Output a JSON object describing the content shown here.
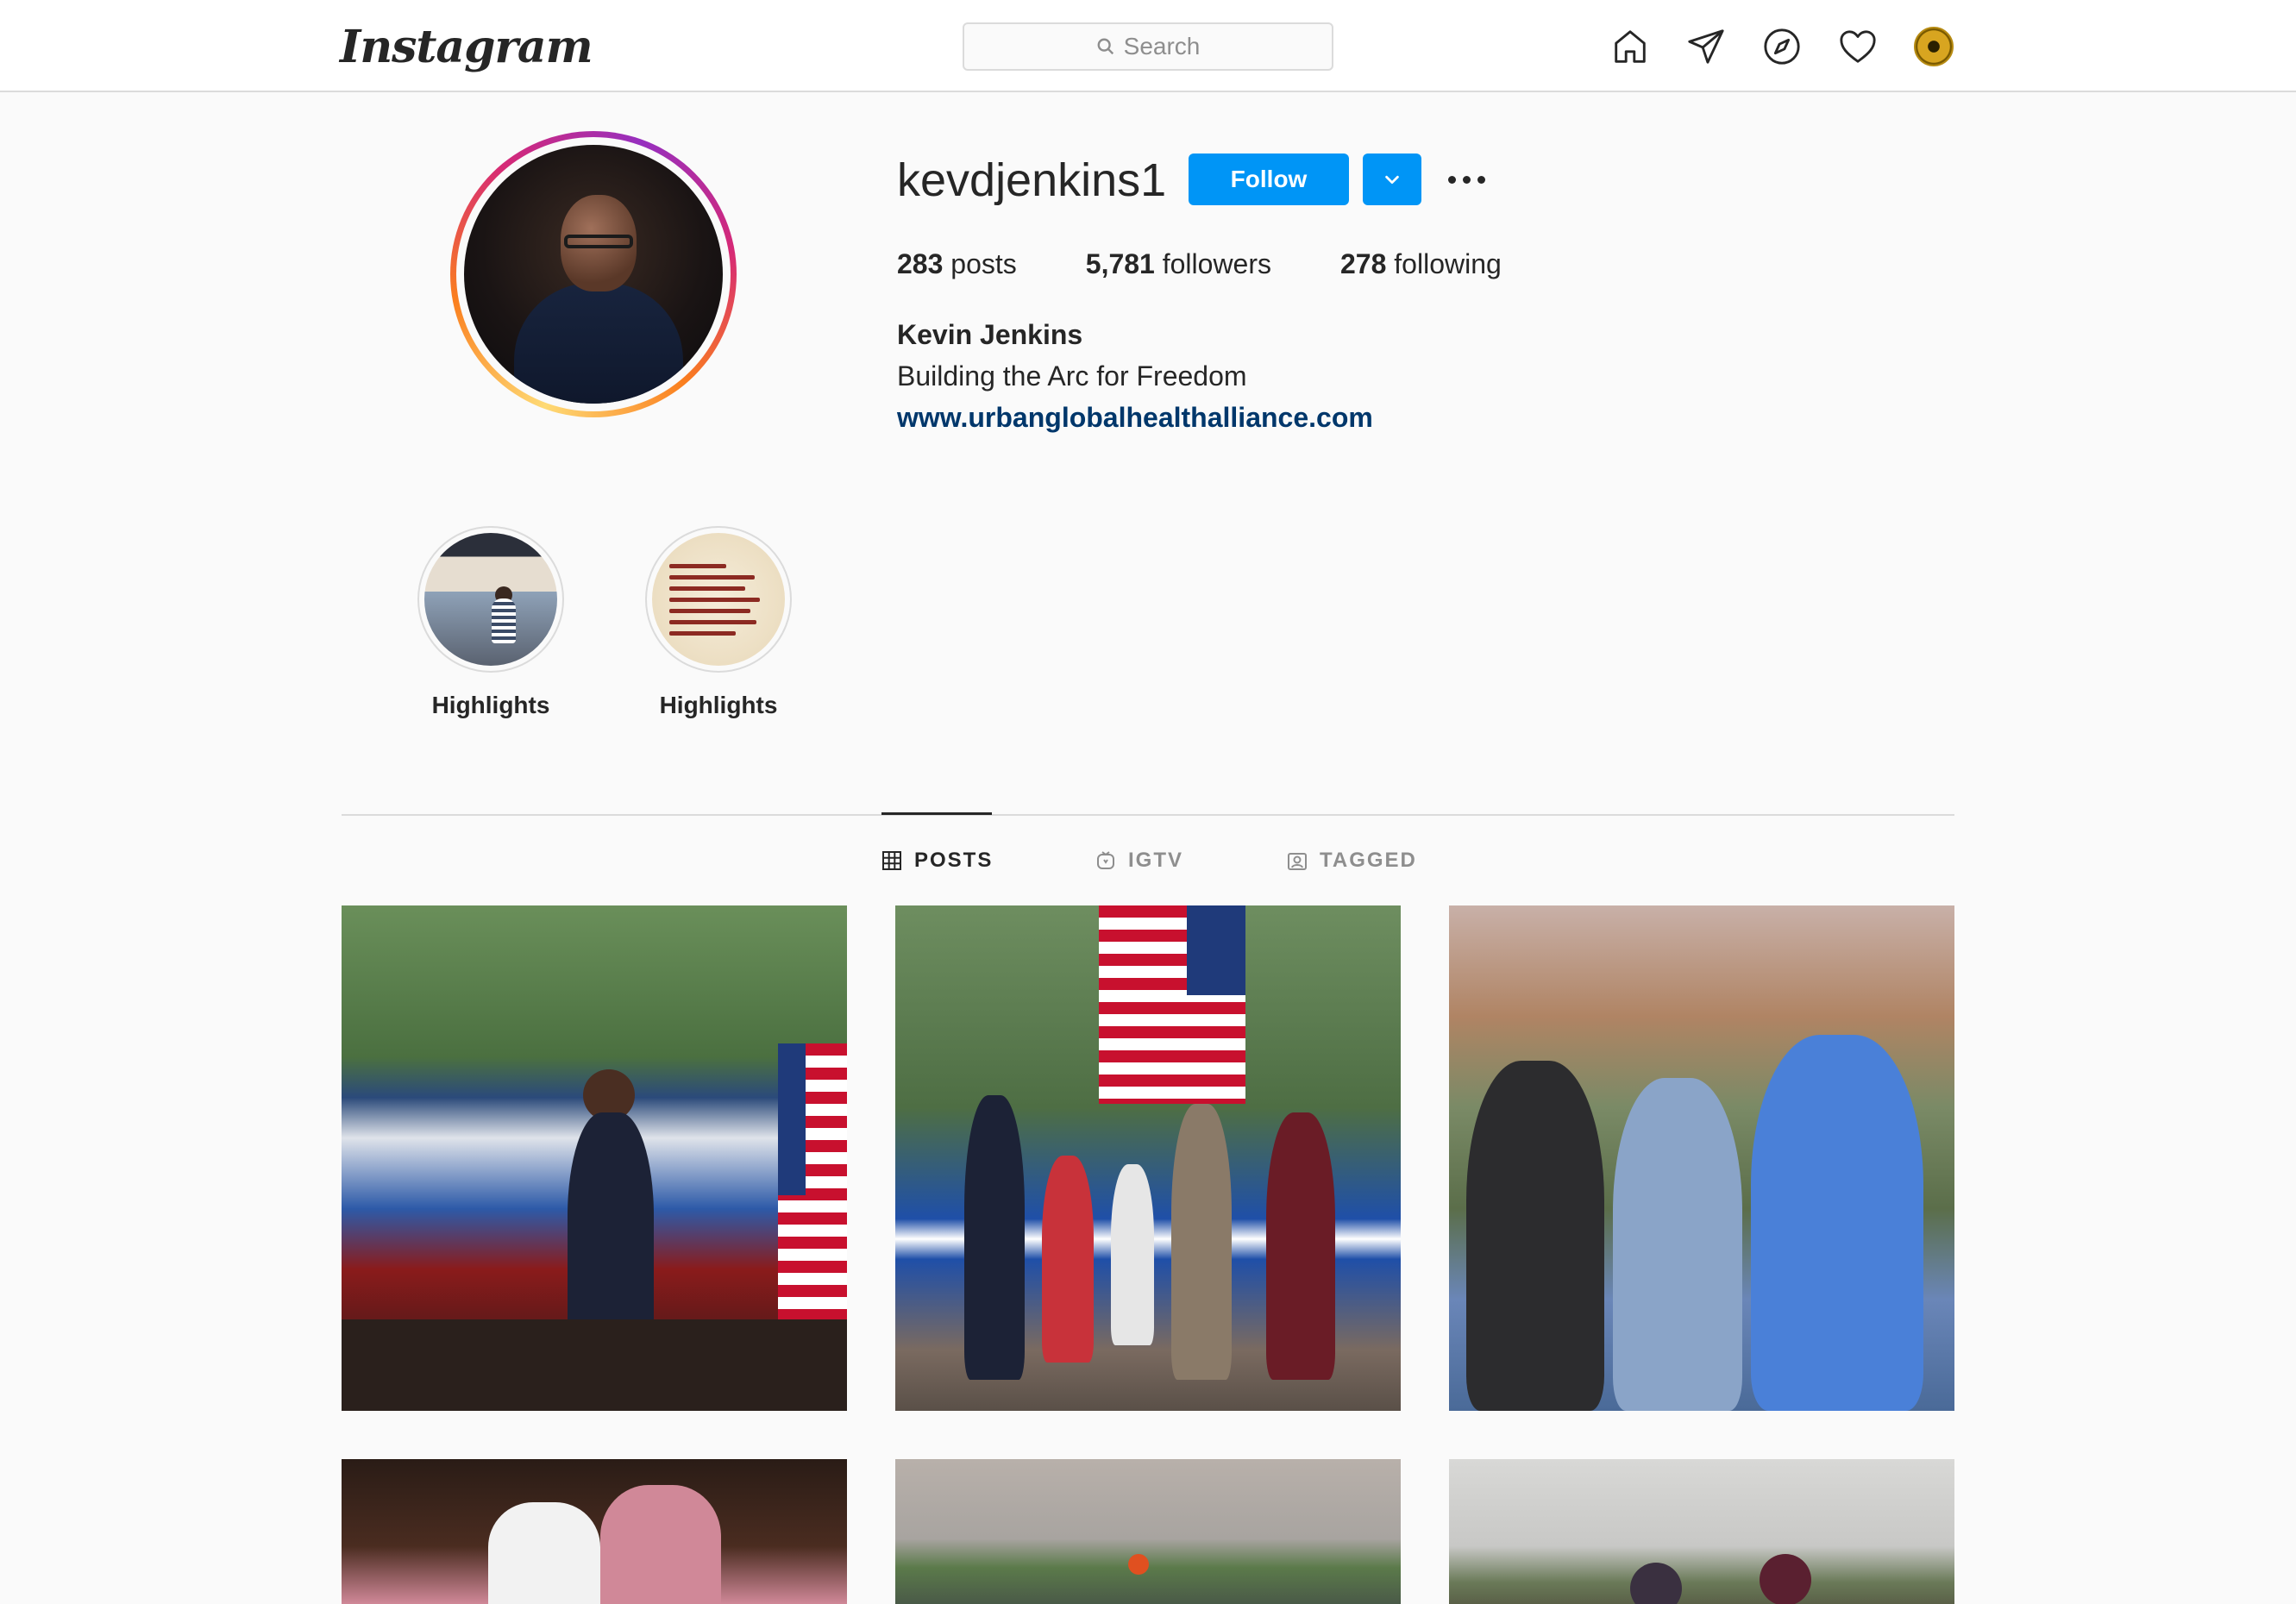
{
  "nav": {
    "logo": "Instagram",
    "search_placeholder": "Search",
    "icons": [
      "home-icon",
      "direct-message-icon",
      "explore-icon",
      "activity-heart-icon",
      "profile-avatar"
    ]
  },
  "profile": {
    "username": "kevdjenkins1",
    "follow_label": "Follow",
    "stats": {
      "posts_count": "283",
      "posts_label": "posts",
      "followers_count": "5,781",
      "followers_label": "followers",
      "following_count": "278",
      "following_label": "following"
    },
    "full_name": "Kevin Jenkins",
    "bio": "Building the Arc for Freedom",
    "website": "www.urbanglobalhealthalliance.com"
  },
  "highlights": [
    {
      "label": "Highlights"
    },
    {
      "label": "Highlights"
    }
  ],
  "tabs": [
    {
      "label": "POSTS",
      "active": true,
      "icon": "grid-icon"
    },
    {
      "label": "IGTV",
      "active": false,
      "icon": "igtv-icon"
    },
    {
      "label": "TAGGED",
      "active": false,
      "icon": "tagged-icon"
    }
  ],
  "colors": {
    "accent": "#0095f6",
    "link": "#00376b",
    "border": "#dbdbdb",
    "background": "#fafafa"
  }
}
